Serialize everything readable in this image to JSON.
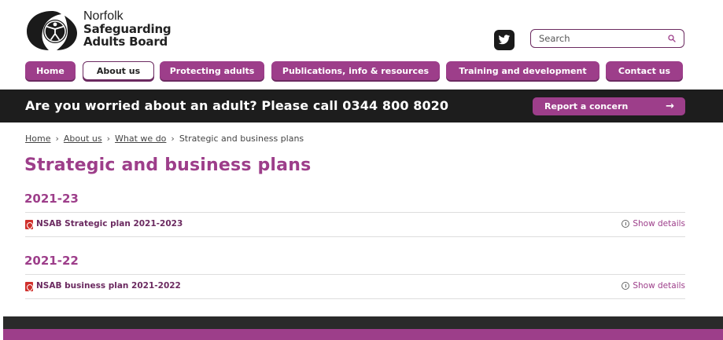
{
  "header": {
    "logo_line1": "Norfolk",
    "logo_line2": "Safeguarding",
    "logo_line3": "Adults Board",
    "search_placeholder": "Search"
  },
  "nav": {
    "items": [
      {
        "label": "Home",
        "active": false
      },
      {
        "label": "About us",
        "active": true
      },
      {
        "label": "Protecting adults",
        "active": false
      },
      {
        "label": "Publications, info & resources",
        "active": false
      },
      {
        "label": "Training and development",
        "active": false
      },
      {
        "label": "Contact us",
        "active": false
      }
    ]
  },
  "banner": {
    "text": "Are you worried about an adult? Please call 0344 800 8020",
    "button_label": "Report a concern",
    "arrow": "→"
  },
  "breadcrumb": {
    "items": [
      "Home",
      "About us",
      "What we do",
      "Strategic and business plans"
    ],
    "separator": "›"
  },
  "page": {
    "title": "Strategic and business plans",
    "sections": [
      {
        "heading": "2021-23",
        "documents": [
          {
            "title": "NSAB Strategic plan 2021-2023",
            "details_label": "Show details"
          }
        ]
      },
      {
        "heading": "2021-22",
        "documents": [
          {
            "title": "NSAB business plan 2021-2022",
            "details_label": "Show details"
          }
        ]
      }
    ]
  },
  "colors": {
    "brand_purple": "#9d3e8a",
    "dark_purple": "#6b2a60",
    "banner_bg": "#1d1d1d",
    "pdf_red": "#d0312d"
  },
  "icons": {
    "logo": "nsab-logo-icon",
    "twitter": "twitter-icon",
    "search": "search-icon",
    "arrow": "arrow-right-icon",
    "pdf": "pdf-icon",
    "info": "info-icon"
  }
}
